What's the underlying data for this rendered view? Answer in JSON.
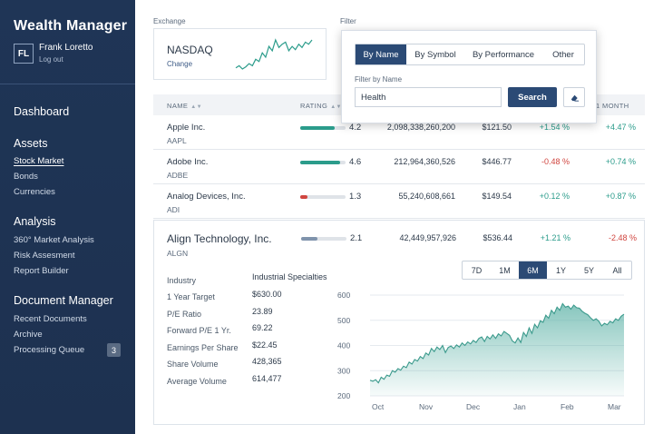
{
  "sidebar": {
    "brand": "Wealth Manager",
    "user_initials": "FL",
    "user_name": "Frank Loretto",
    "logout": "Log out",
    "dashboard": "Dashboard",
    "assets": {
      "title": "Assets",
      "items": [
        "Stock Market",
        "Bonds",
        "Currencies"
      ]
    },
    "analysis": {
      "title": "Analysis",
      "items": [
        "360° Market Analysis",
        "Risk Assesment",
        "Report Builder"
      ]
    },
    "documents": {
      "title": "Document Manager",
      "items": [
        "Recent Documents",
        "Archive",
        "Processing Queue"
      ],
      "queue_count": "3"
    }
  },
  "exchange": {
    "label": "Exchange",
    "name": "NASDAQ",
    "sub": "Change"
  },
  "filter": {
    "label": "Filter",
    "tabs": [
      "By Name",
      "By Symbol",
      "By Performance",
      "Other"
    ],
    "active_tab": "By Name",
    "field_label": "Filter by Name",
    "value": "Health",
    "search_label": "Search"
  },
  "table": {
    "headers": {
      "name": "NAME",
      "rating": "RATING",
      "change_1m": "1 MONTH"
    },
    "rows": [
      {
        "name": "Apple Inc.",
        "ticker": "AAPL",
        "rating": "4.2",
        "cap": "2,098,338,260,200",
        "price": "$121.50",
        "ch1": "+1.54 %",
        "ch2": "+4.47 %"
      },
      {
        "name": "Adobe Inc.",
        "ticker": "ADBE",
        "rating": "4.6",
        "cap": "212,964,360,526",
        "price": "$446.77",
        "ch1": "-0.48 %",
        "ch2": "+0.74 %"
      },
      {
        "name": "Analog Devices, Inc.",
        "ticker": "ADI",
        "rating": "1.3",
        "cap": "55,240,608,661",
        "price": "$149.54",
        "ch1": "+0.12 %",
        "ch2": "+0.87 %"
      }
    ],
    "expanded": {
      "name": "Align Technology, Inc.",
      "ticker": "ALGN",
      "rating": "2.1",
      "cap": "42,449,957,926",
      "price": "$536.44",
      "ch1": "+1.21 %",
      "ch2": "-2.48 %",
      "stats": [
        {
          "label": "Industry",
          "value": "Industrial Specialties"
        },
        {
          "label": "1 Year Target",
          "value": "$630.00"
        },
        {
          "label": "P/E Ratio",
          "value": "23.89"
        },
        {
          "label": "Forward P/E 1 Yr.",
          "value": "69.22"
        },
        {
          "label": "Earnings Per Share",
          "value": "$22.45"
        },
        {
          "label": "Share Volume",
          "value": "428,365"
        },
        {
          "label": "Average Volume",
          "value": "614,477"
        }
      ],
      "ranges": [
        "7D",
        "1M",
        "6M",
        "1Y",
        "5Y",
        "All"
      ],
      "active_range": "6M"
    }
  },
  "colors": {
    "accent": "#2b4a75",
    "positive": "#2b9c8b",
    "negative": "#d0453f",
    "rating_high": "#2b9c8b",
    "rating_low": "#d0453f",
    "rating_mid": "#7f93ac"
  },
  "chart_data": {
    "type": "area",
    "title": "",
    "xlabel": "",
    "ylabel": "",
    "x_ticks": [
      "Oct",
      "Nov",
      "Dec",
      "Jan",
      "Feb",
      "Mar"
    ],
    "y_ticks": [
      200,
      300,
      400,
      500,
      600
    ],
    "ylim": [
      200,
      600
    ],
    "grid": true,
    "series": [
      {
        "values": [
          262,
          258,
          264,
          252,
          274,
          266,
          282,
          278,
          300,
          294,
          308,
          302,
          318,
          312,
          334,
          326,
          344,
          338,
          356,
          348,
          370,
          362,
          388,
          376,
          394,
          384,
          400,
          372,
          392,
          398,
          388,
          402,
          394,
          410,
          400,
          414,
          406,
          420,
          412,
          428,
          434,
          416,
          436,
          426,
          442,
          428,
          446,
          438,
          456,
          448,
          440,
          418,
          410,
          430,
          412,
          452,
          436,
          470,
          448,
          484,
          470,
          498,
          492,
          520,
          508,
          540,
          526,
          552,
          540,
          566,
          552,
          556,
          544,
          560,
          550,
          548,
          536,
          528,
          522,
          510,
          500,
          506,
          496,
          478,
          488,
          482,
          496,
          490,
          506,
          500,
          516,
          524
        ]
      }
    ]
  },
  "nasdaq_spark": [
    14,
    16,
    13,
    15,
    18,
    16,
    22,
    20,
    28,
    24,
    34,
    30,
    40,
    33,
    36,
    38,
    30,
    34,
    31,
    36,
    33,
    38,
    36,
    40
  ]
}
